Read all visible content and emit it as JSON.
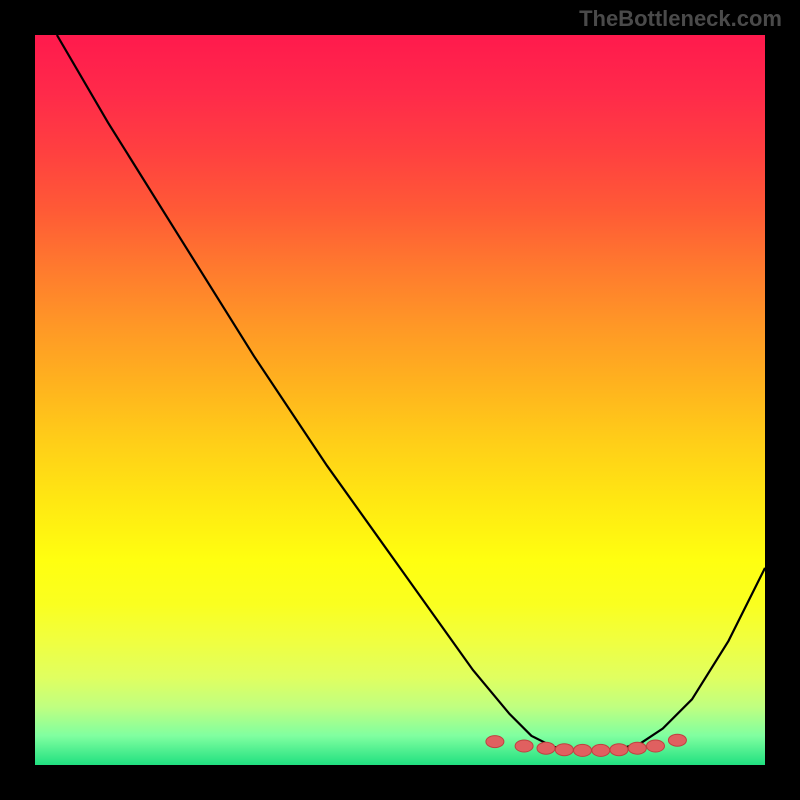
{
  "watermark": "TheBottleneck.com",
  "chart_data": {
    "type": "line",
    "title": "",
    "xlabel": "",
    "ylabel": "",
    "xlim": [
      0,
      100
    ],
    "ylim": [
      0,
      100
    ],
    "grid": false,
    "legend": false,
    "background": "vertical-gradient red-to-green",
    "series": [
      {
        "name": "curve",
        "x": [
          3,
          10,
          20,
          30,
          40,
          50,
          60,
          65,
          68,
          71,
          74,
          77,
          80,
          83,
          86,
          90,
          95,
          100
        ],
        "values": [
          100,
          88,
          72,
          56,
          41,
          27,
          13,
          7,
          4,
          2.5,
          2,
          2,
          2.2,
          3,
          5,
          9,
          17,
          27
        ]
      }
    ],
    "points": {
      "name": "highlight-dots",
      "x": [
        63,
        67,
        70,
        72.5,
        75,
        77.5,
        80,
        82.5,
        85,
        88
      ],
      "values": [
        3.2,
        2.6,
        2.3,
        2.1,
        2.0,
        2.0,
        2.1,
        2.3,
        2.6,
        3.4
      ]
    }
  }
}
